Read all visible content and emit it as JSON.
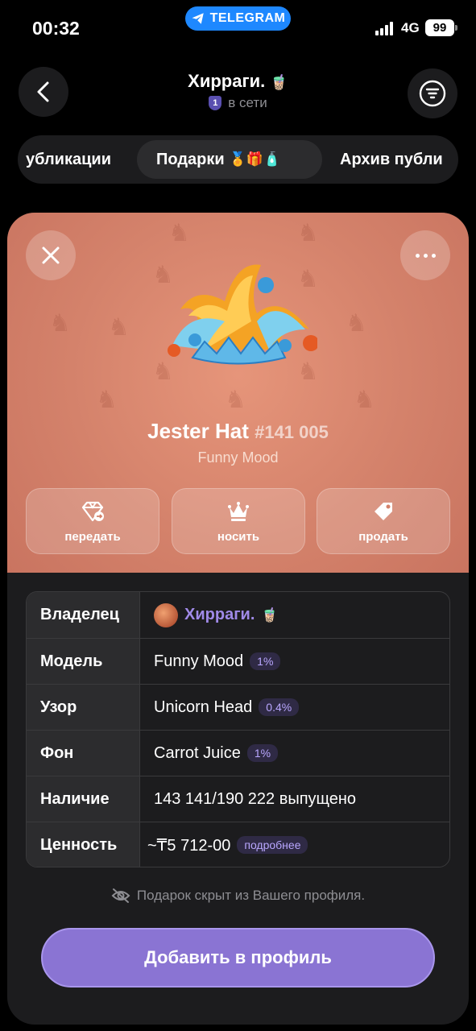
{
  "status_bar": {
    "time": "00:32",
    "pill": "TELEGRAM",
    "network": "4G",
    "battery": "99"
  },
  "header": {
    "name": "Хирраги.",
    "level_badge": "1",
    "status": "в сети",
    "tabs": [
      {
        "label": "убликации"
      },
      {
        "label": "Подарки"
      },
      {
        "label": "Архив публи"
      }
    ]
  },
  "gift": {
    "name": "Jester Hat",
    "number": "#141 005",
    "model": "Funny Mood",
    "actions": [
      {
        "label": "передать",
        "icon": "gift-transfer-icon"
      },
      {
        "label": "носить",
        "icon": "crown-icon"
      },
      {
        "label": "продать",
        "icon": "price-tag-icon"
      }
    ]
  },
  "info": {
    "owner": {
      "key": "Владелец",
      "value": "Хирраги."
    },
    "model": {
      "key": "Модель",
      "value": "Funny Mood",
      "rarity": "1%"
    },
    "pattern": {
      "key": "Узор",
      "value": "Unicorn Head",
      "rarity": "0.4%"
    },
    "backdrop": {
      "key": "Фон",
      "value": "Carrot Juice",
      "rarity": "1%"
    },
    "supply": {
      "key": "Наличие",
      "value": "143 141/190 222 выпущено"
    },
    "value": {
      "key": "Ценность",
      "value": "~₸5 712-00",
      "more": "подробнее"
    }
  },
  "note": "Подарок скрыт из Вашего профиля.",
  "primary_button": "Добавить в профиль",
  "colors": {
    "accent": "#8a74d3",
    "hero_bg": "#d4826b",
    "telegram_blue": "#1e88ff"
  }
}
